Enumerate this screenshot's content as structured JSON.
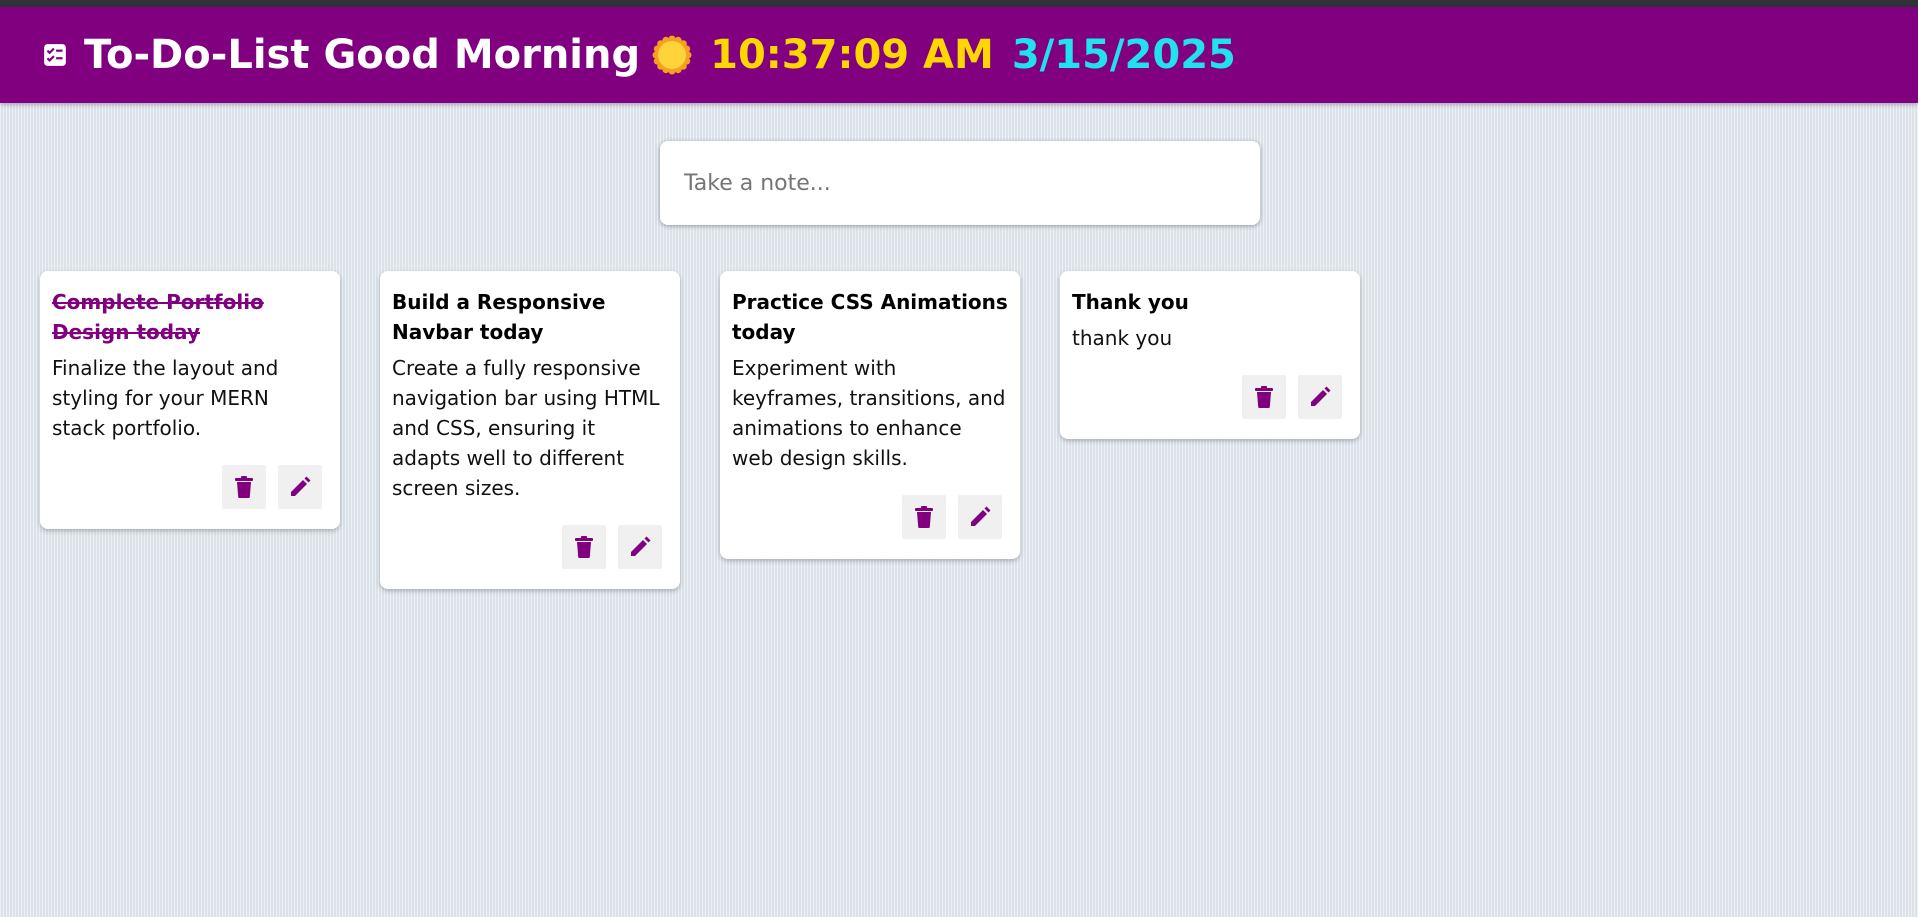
{
  "header": {
    "title": "To-Do-List",
    "greeting": "Good Morning",
    "time": "10:37:09 AM",
    "date": "3/15/2025",
    "icons": [
      "checklist-icon",
      "sun-icon"
    ]
  },
  "note_input": {
    "placeholder": "Take a note...",
    "value": ""
  },
  "notes": [
    {
      "title": "Complete Portfolio Design today",
      "content": "Finalize the layout and styling for your MERN stack portfolio.",
      "completed": true
    },
    {
      "title": "Build a Responsive Navbar today",
      "content": "Create a fully responsive navigation bar using HTML and CSS, ensuring it adapts well to different screen sizes.",
      "completed": false
    },
    {
      "title": "Practice CSS Animations today",
      "content": "Experiment with keyframes, transitions, and animations to enhance web design skills.",
      "completed": false
    },
    {
      "title": "Thank you",
      "content": "thank you",
      "completed": false
    }
  ],
  "note_actions": {
    "delete_icon": "trash-icon",
    "edit_icon": "pencil-icon"
  },
  "colors": {
    "brand": "#800080",
    "time": "#ffd700",
    "date": "#22e1ee",
    "background": "#e4eaf1"
  }
}
